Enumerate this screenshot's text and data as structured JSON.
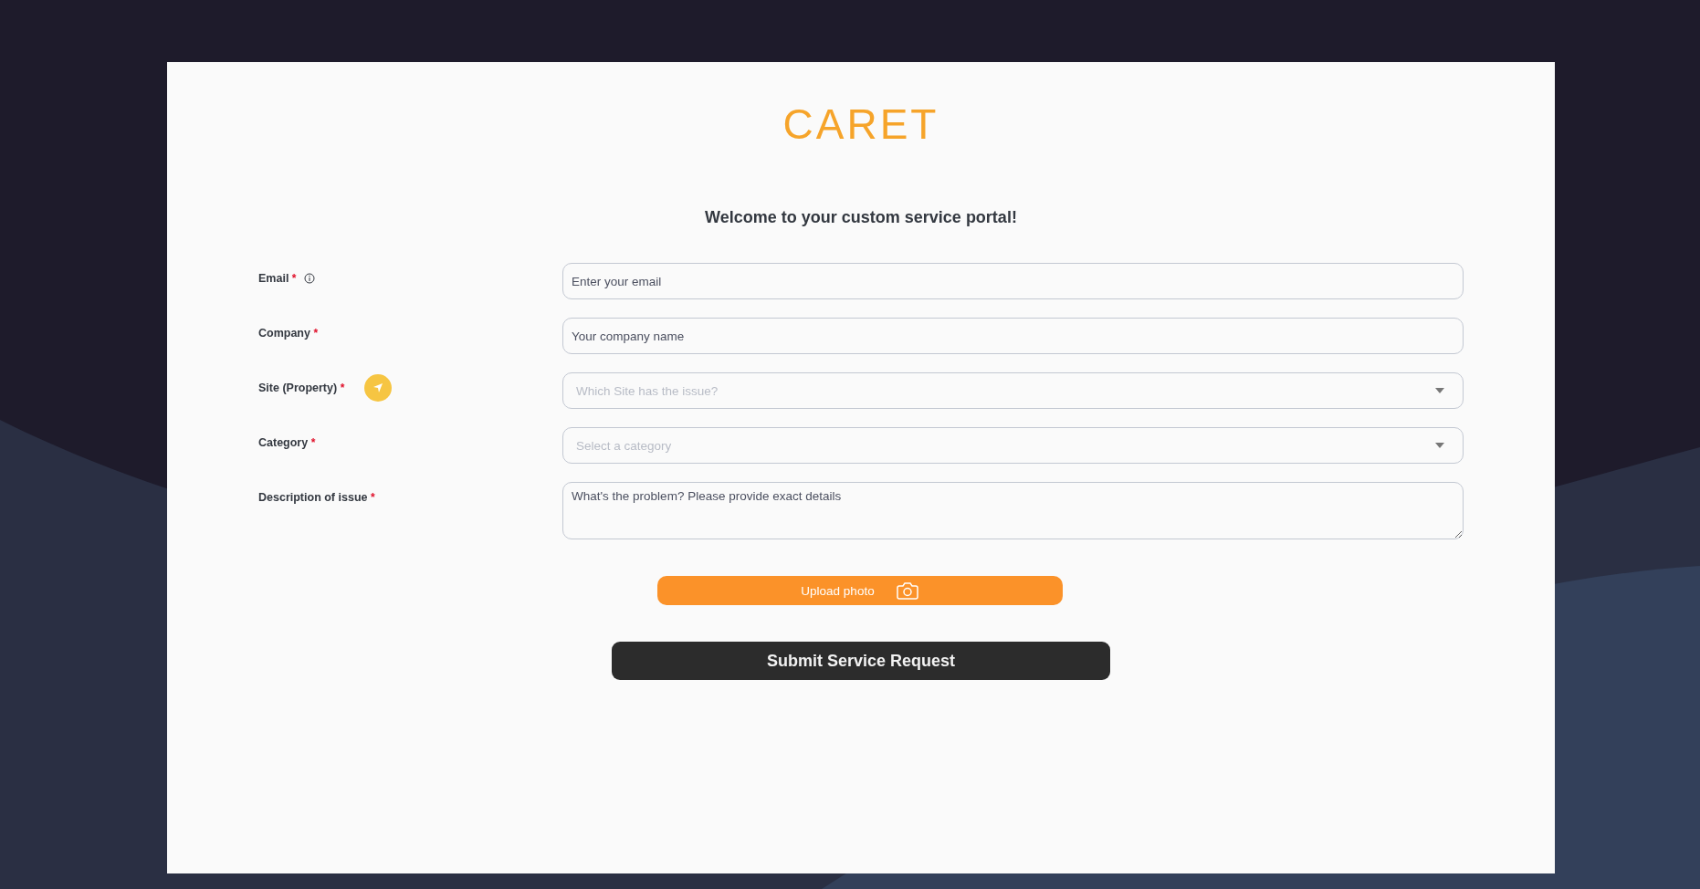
{
  "logo": "CARET",
  "heading": "Welcome to your custom service portal!",
  "fields": [
    {
      "label": "Email",
      "required_mark": "*",
      "kind": "text",
      "placeholder": "Enter your email",
      "info": true,
      "locate": false
    },
    {
      "label": "Company",
      "required_mark": "*",
      "kind": "text",
      "placeholder": "Your company name",
      "info": false,
      "locate": false
    },
    {
      "label": "Site (Property)",
      "required_mark": "*",
      "kind": "select",
      "placeholder": "Which Site has the issue?",
      "info": false,
      "locate": true
    },
    {
      "label": "Category",
      "required_mark": "*",
      "kind": "select",
      "placeholder": "Select a category",
      "info": false,
      "locate": false
    },
    {
      "label": "Description of issue",
      "required_mark": "*",
      "kind": "textarea",
      "placeholder": "What's the problem? Please provide exact details",
      "info": false,
      "locate": false
    }
  ],
  "upload_button": "Upload photo",
  "submit_button": "Submit Service Request"
}
